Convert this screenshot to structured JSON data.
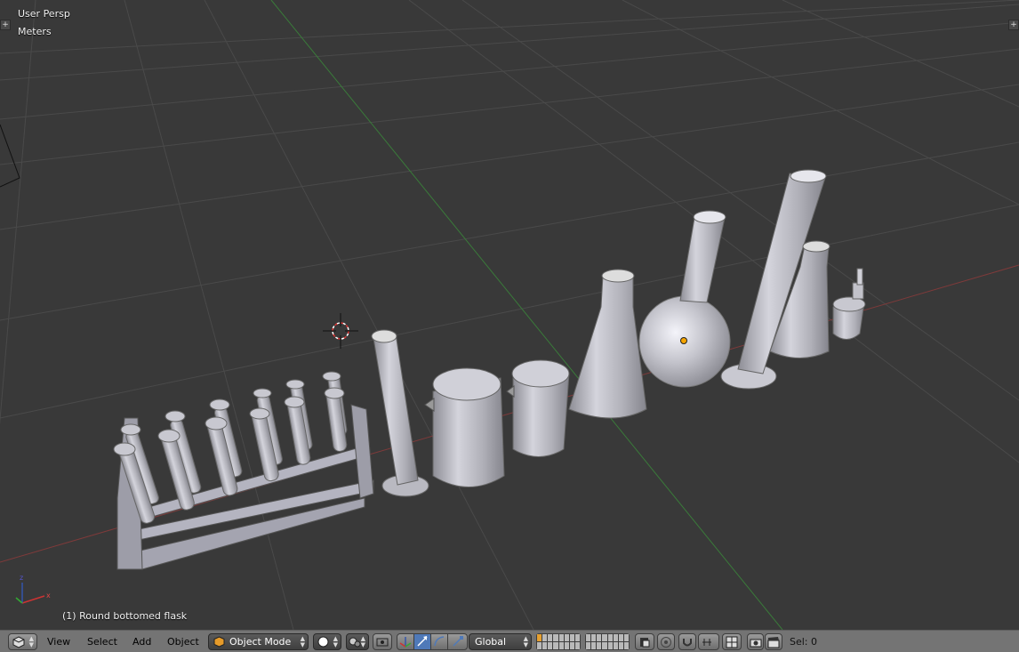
{
  "viewport": {
    "view_name": "User Persp",
    "units": "Meters",
    "selected_object_label": "(1) Round bottomed flask"
  },
  "header": {
    "editor_type_icon": "3d-view-editor-icon",
    "menus": [
      "View",
      "Select",
      "Add",
      "Object"
    ],
    "mode": "Object Mode",
    "mode_icon": "object-mode-cube-icon",
    "shading_icon": "viewport-shading-solid-icon",
    "pivot_icon": "pivot-point-icon",
    "orientation": "Global",
    "status": "Sel: 0"
  },
  "colors": {
    "viewport_bg": "#393939",
    "grid": "#4b4b4b",
    "x_axis": "#8a3b3b",
    "y_axis": "#3e7a3e",
    "object": "#aeaeb6",
    "header_bg": "#747474"
  },
  "scene_objects": [
    "test-tube-rack",
    "graduated-cylinder",
    "beaker-large",
    "beaker-small",
    "erlenmeyer-flask",
    "round-bottomed-flask",
    "tall-graduated-cylinder",
    "small-erlenmeyer-flask",
    "dropper-bottle"
  ]
}
